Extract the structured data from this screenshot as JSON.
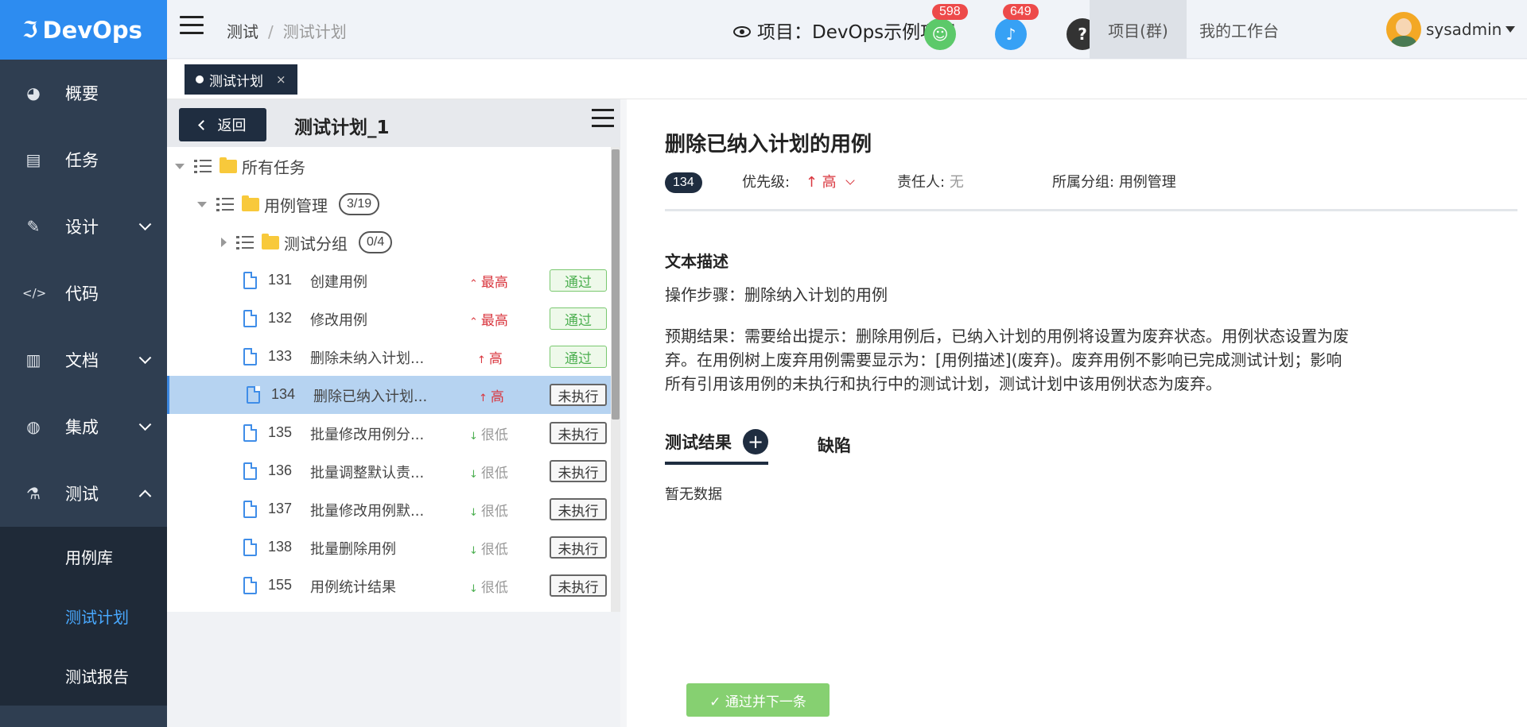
{
  "brand": {
    "name": "DevOps",
    "accent": "#2d8cf0"
  },
  "sidebar": {
    "items": [
      {
        "label": "概要",
        "icon": "dashboard-icon"
      },
      {
        "label": "任务",
        "icon": "task-icon"
      },
      {
        "label": "设计",
        "icon": "design-icon"
      },
      {
        "label": "代码",
        "icon": "code-icon"
      },
      {
        "label": "文档",
        "icon": "document-icon"
      },
      {
        "label": "集成",
        "icon": "integration-icon"
      },
      {
        "label": "测试",
        "icon": "flask-icon"
      }
    ],
    "sub_items": [
      {
        "label": "用例库"
      },
      {
        "label": "测试计划"
      },
      {
        "label": "测试报告"
      }
    ]
  },
  "header": {
    "breadcrumb": [
      "测试",
      "测试计划"
    ],
    "project": "项目：DevOps示例项目",
    "badges": [
      "598",
      "649"
    ],
    "help": "?",
    "tabs": [
      "项目(群)",
      "我的工作台"
    ],
    "username": "sysadmin"
  },
  "tabstrip": {
    "tab_label": "测试计划",
    "close": "×"
  },
  "left": {
    "back": "返回",
    "plan_title": "测试计划_1",
    "tree": {
      "root": "所有任务",
      "group": {
        "label": "用例管理",
        "count": "3/19"
      },
      "subgroup": {
        "label": "测试分组",
        "count": "0/4"
      }
    },
    "cases": [
      {
        "id": "131",
        "name": "创建用例",
        "priority": "最高",
        "status": "通过"
      },
      {
        "id": "132",
        "name": "修改用例",
        "priority": "最高",
        "status": "通过"
      },
      {
        "id": "133",
        "name": "删除未纳入计划...",
        "priority": "高",
        "status": "通过"
      },
      {
        "id": "134",
        "name": "删除已纳入计划...",
        "priority": "高",
        "status": "未执行"
      },
      {
        "id": "135",
        "name": "批量修改用例分...",
        "priority": "很低",
        "status": "未执行"
      },
      {
        "id": "136",
        "name": "批量调整默认责...",
        "priority": "很低",
        "status": "未执行"
      },
      {
        "id": "137",
        "name": "批量修改用例默...",
        "priority": "很低",
        "status": "未执行"
      },
      {
        "id": "138",
        "name": "批量删除用例",
        "priority": "很低",
        "status": "未执行"
      },
      {
        "id": "155",
        "name": "用例统计结果",
        "priority": "很低",
        "status": "未执行"
      }
    ]
  },
  "detail": {
    "title": "删除已纳入计划的用例",
    "id": "134",
    "priority_label": "优先级:",
    "priority_value": "高",
    "owner_label": "责任人:",
    "owner_value": "无",
    "group_label": "所属分组:",
    "group_value": "用例管理",
    "section_title": "文本描述",
    "steps": "操作步骤：删除纳入计划的用例",
    "expected": "预期结果：需要给出提示：删除用例后，已纳入计划的用例将设置为废弃状态。用例状态设置为废弃。在用例树上废弃用例需要显示为：[用例描述](废弃)。废弃用例不影响已完成测试计划；影响所有引用该用例的未执行和执行中的测试计划，测试计划中该用例状态为废弃。",
    "tabs": [
      "测试结果",
      "缺陷"
    ],
    "plus": "+",
    "empty": "暂无数据",
    "pass_next": "✓ 通过并下一条"
  }
}
